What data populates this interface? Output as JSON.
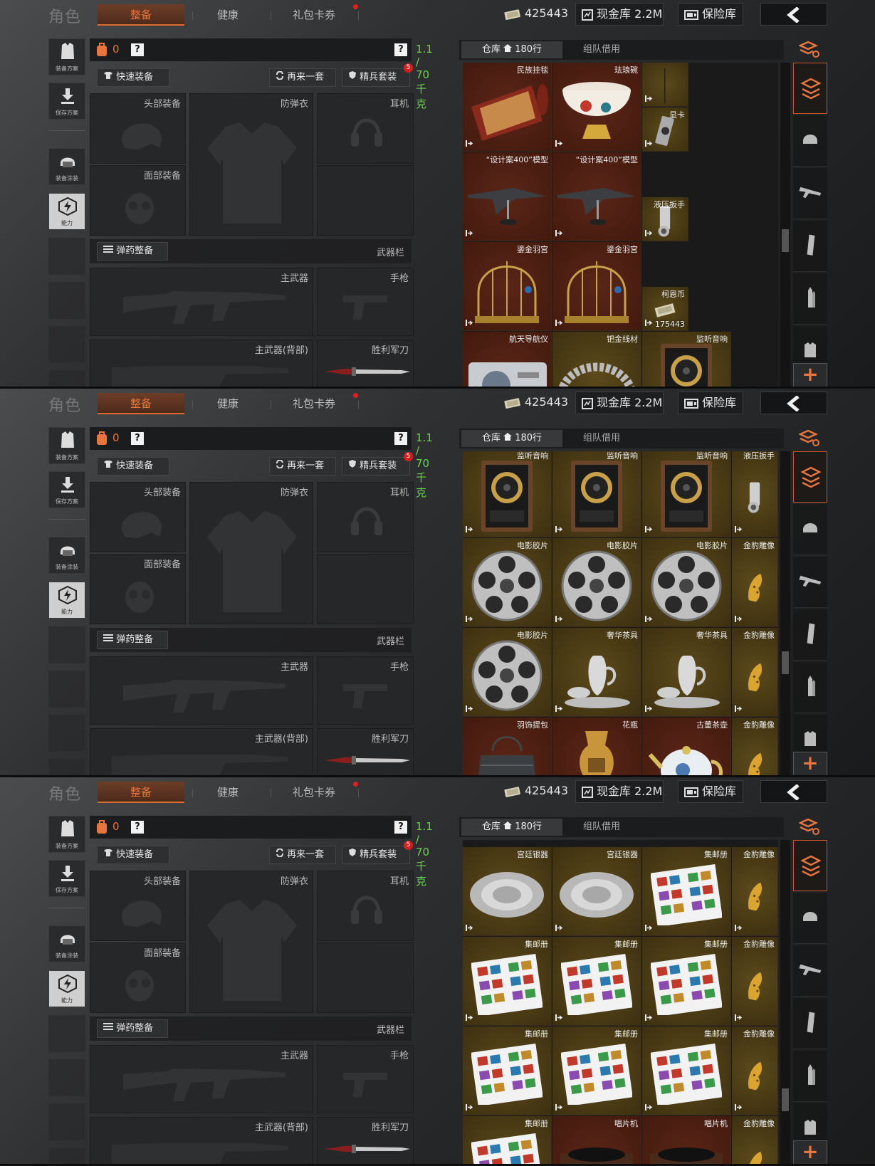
{
  "header": {
    "role_title": "角色",
    "tabs": [
      "整备",
      "健康",
      "礼包卡券"
    ],
    "currency": "425443",
    "cash_vault": "现金库 2.2M",
    "safe_box": "保险库"
  },
  "left_menu": {
    "loadout_plan": "装备方案",
    "save_plan": "保存方案",
    "paint": "装备涂装",
    "ability": "能力"
  },
  "equipment": {
    "count": "0",
    "help": "?",
    "weight": "1.1 / 70 千克",
    "quick_equip": "快速装备",
    "again": "再来一套",
    "elite": "精兵套装",
    "elite_badge": "5",
    "head": "头部装备",
    "armor": "防弹衣",
    "ear": "耳机",
    "face": "面部装备",
    "ammo": "弹药整备",
    "weapon_bar": "武器栏",
    "primary": "主武器",
    "pistol": "手枪",
    "primary_back": "主武器(背部)",
    "knife": "胜利军刀"
  },
  "warehouse": {
    "tab_warehouse": "仓库",
    "rows": "180行",
    "tab_team": "组队借用"
  },
  "panels": [
    {
      "cells": [
        {
          "name": "民族挂毯",
          "icon": "rug",
          "bg": "red",
          "col": 0,
          "row": 0
        },
        {
          "name": "珐琅碗",
          "icon": "bowl",
          "bg": "red",
          "col": 1,
          "row": 0
        },
        {
          "name": "",
          "icon": "pole",
          "bg": "gold",
          "col": 2,
          "row": 0,
          "narrow": true
        },
        {
          "name": "显卡",
          "icon": "gpu",
          "bg": "gold",
          "col": 2,
          "row": 0.5,
          "narrow": true
        },
        {
          "name": "“设计案400”模型",
          "icon": "plane",
          "bg": "red",
          "col": 0,
          "row": 1
        },
        {
          "name": "“设计案400”模型",
          "icon": "plane",
          "bg": "red",
          "col": 1,
          "row": 1
        },
        {
          "name": "液压扳手",
          "icon": "wrench",
          "bg": "gold",
          "col": 2,
          "row": 1.5,
          "narrow": true
        },
        {
          "name": "鎏金羽宫",
          "icon": "cage",
          "bg": "red",
          "col": 0,
          "row": 2
        },
        {
          "name": "鎏金羽宫",
          "icon": "cage",
          "bg": "red",
          "col": 1,
          "row": 2
        },
        {
          "name": "柯恩币",
          "icon": "cash",
          "bg": "gold",
          "col": 2,
          "row": 2.5,
          "narrow": true,
          "qty": "175443"
        },
        {
          "name": "航天导航仪",
          "icon": "nav",
          "bg": "red",
          "col": 0,
          "row": 3
        },
        {
          "name": "钯金线材",
          "icon": "wire",
          "bg": "gold",
          "col": 1,
          "row": 3
        },
        {
          "name": "监听音响",
          "icon": "speaker",
          "bg": "gold",
          "col": 2,
          "row": 3
        }
      ],
      "scroll": 0.55
    },
    {
      "cells": [
        {
          "name": "监听音响",
          "icon": "speaker",
          "bg": "gold",
          "col": 0,
          "row": 0
        },
        {
          "name": "监听音响",
          "icon": "speaker",
          "bg": "gold",
          "col": 1,
          "row": 0
        },
        {
          "name": "监听音响",
          "icon": "speaker",
          "bg": "gold",
          "col": 2,
          "row": 0
        },
        {
          "name": "液压扳手",
          "icon": "wrench",
          "bg": "gold",
          "col": 3,
          "row": 0,
          "narrow": true
        },
        {
          "name": "电影胶片",
          "icon": "reel",
          "bg": "gold",
          "col": 0,
          "row": 1
        },
        {
          "name": "电影胶片",
          "icon": "reel",
          "bg": "gold",
          "col": 1,
          "row": 1
        },
        {
          "name": "电影胶片",
          "icon": "reel",
          "bg": "gold",
          "col": 2,
          "row": 1
        },
        {
          "name": "金豹雕像",
          "icon": "leopard",
          "bg": "gold",
          "col": 3,
          "row": 1,
          "narrow": true
        },
        {
          "name": "电影胶片",
          "icon": "reel",
          "bg": "gold",
          "col": 0,
          "row": 2
        },
        {
          "name": "奢华茶具",
          "icon": "teaset",
          "bg": "gold",
          "col": 1,
          "row": 2
        },
        {
          "name": "奢华茶具",
          "icon": "teaset",
          "bg": "gold",
          "col": 2,
          "row": 2
        },
        {
          "name": "金豹雕像",
          "icon": "leopard",
          "bg": "gold",
          "col": 3,
          "row": 2,
          "narrow": true
        },
        {
          "name": "羽饰提包",
          "icon": "bag",
          "bg": "red",
          "col": 0,
          "row": 3
        },
        {
          "name": "花瓶",
          "icon": "vase",
          "bg": "red",
          "col": 1,
          "row": 3
        },
        {
          "name": "古董茶壶",
          "icon": "teapot",
          "bg": "red",
          "col": 2,
          "row": 3
        },
        {
          "name": "金豹雕像",
          "icon": "leopard",
          "bg": "gold",
          "col": 3,
          "row": 3,
          "narrow": true
        }
      ],
      "scroll": 0.66
    },
    {
      "cells": [
        {
          "name": "宫廷银器",
          "icon": "plate",
          "bg": "gold",
          "col": 0,
          "row": 0
        },
        {
          "name": "宫廷银器",
          "icon": "plate",
          "bg": "gold",
          "col": 1,
          "row": 0
        },
        {
          "name": "集邮册",
          "icon": "stamps",
          "bg": "gold",
          "col": 2,
          "row": 0
        },
        {
          "name": "金豹雕像",
          "icon": "leopard",
          "bg": "gold",
          "col": 3,
          "row": 0,
          "narrow": true
        },
        {
          "name": "集邮册",
          "icon": "stamps",
          "bg": "gold",
          "col": 0,
          "row": 1
        },
        {
          "name": "集邮册",
          "icon": "stamps",
          "bg": "gold",
          "col": 1,
          "row": 1
        },
        {
          "name": "集邮册",
          "icon": "stamps",
          "bg": "gold",
          "col": 2,
          "row": 1
        },
        {
          "name": "金豹雕像",
          "icon": "leopard",
          "bg": "gold",
          "col": 3,
          "row": 1,
          "narrow": true
        },
        {
          "name": "集邮册",
          "icon": "stamps",
          "bg": "gold",
          "col": 0,
          "row": 2
        },
        {
          "name": "集邮册",
          "icon": "stamps",
          "bg": "gold",
          "col": 1,
          "row": 2
        },
        {
          "name": "集邮册",
          "icon": "stamps",
          "bg": "gold",
          "col": 2,
          "row": 2
        },
        {
          "name": "金豹雕像",
          "icon": "leopard",
          "bg": "gold",
          "col": 3,
          "row": 2,
          "narrow": true
        },
        {
          "name": "集邮册",
          "icon": "stamps",
          "bg": "gold",
          "col": 0,
          "row": 3
        },
        {
          "name": "唱片机",
          "icon": "record",
          "bg": "red",
          "col": 1,
          "row": 3
        },
        {
          "name": "唱片机",
          "icon": "record",
          "bg": "red",
          "col": 2,
          "row": 3
        },
        {
          "name": "金豹雕像",
          "icon": "leopard",
          "bg": "gold",
          "col": 3,
          "row": 3,
          "narrow": true
        }
      ],
      "scroll": 0.82
    }
  ],
  "colors": {
    "accent": "#e8743e",
    "weight_green": "#6bd24a",
    "cell_red": "#4b1d10",
    "cell_gold": "#4d3d14"
  }
}
